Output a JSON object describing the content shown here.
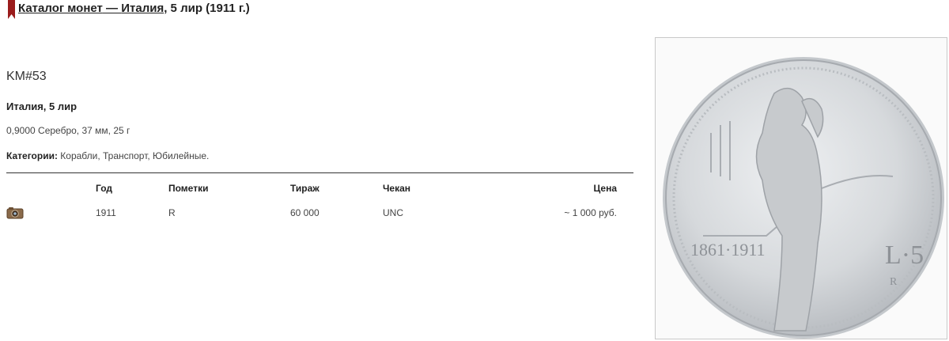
{
  "breadcrumb": {
    "catalog_label": "Каталог монет",
    "separator": " — ",
    "country_label": "Италия",
    "suffix": ", 5 лир (1911 г.)"
  },
  "coin": {
    "km": "KM#53",
    "title": "Италия, 5 лир",
    "specs": "0,9000 Серебро, 37 мм, 25 г",
    "categories_label": "Категории:",
    "categories_value": " Корабли, Транспорт, Юбилейные."
  },
  "table": {
    "headers": {
      "year": "Год",
      "marks": "Пометки",
      "mintage": "Тираж",
      "grade": "Чекан",
      "price": "Цена"
    },
    "rows": [
      {
        "photo_icon": "camera-icon",
        "year": "1911",
        "marks": "R",
        "mintage": "60 000",
        "grade": "UNC",
        "price": "~ 1 000 руб."
      }
    ]
  },
  "image": {
    "legend_left": "1861·1911",
    "denomination": "L·5",
    "mint_mark": "R"
  },
  "colors": {
    "bookmark": "#9b1c1c",
    "text": "#333333",
    "coin_silver": "#d9dcdf"
  }
}
